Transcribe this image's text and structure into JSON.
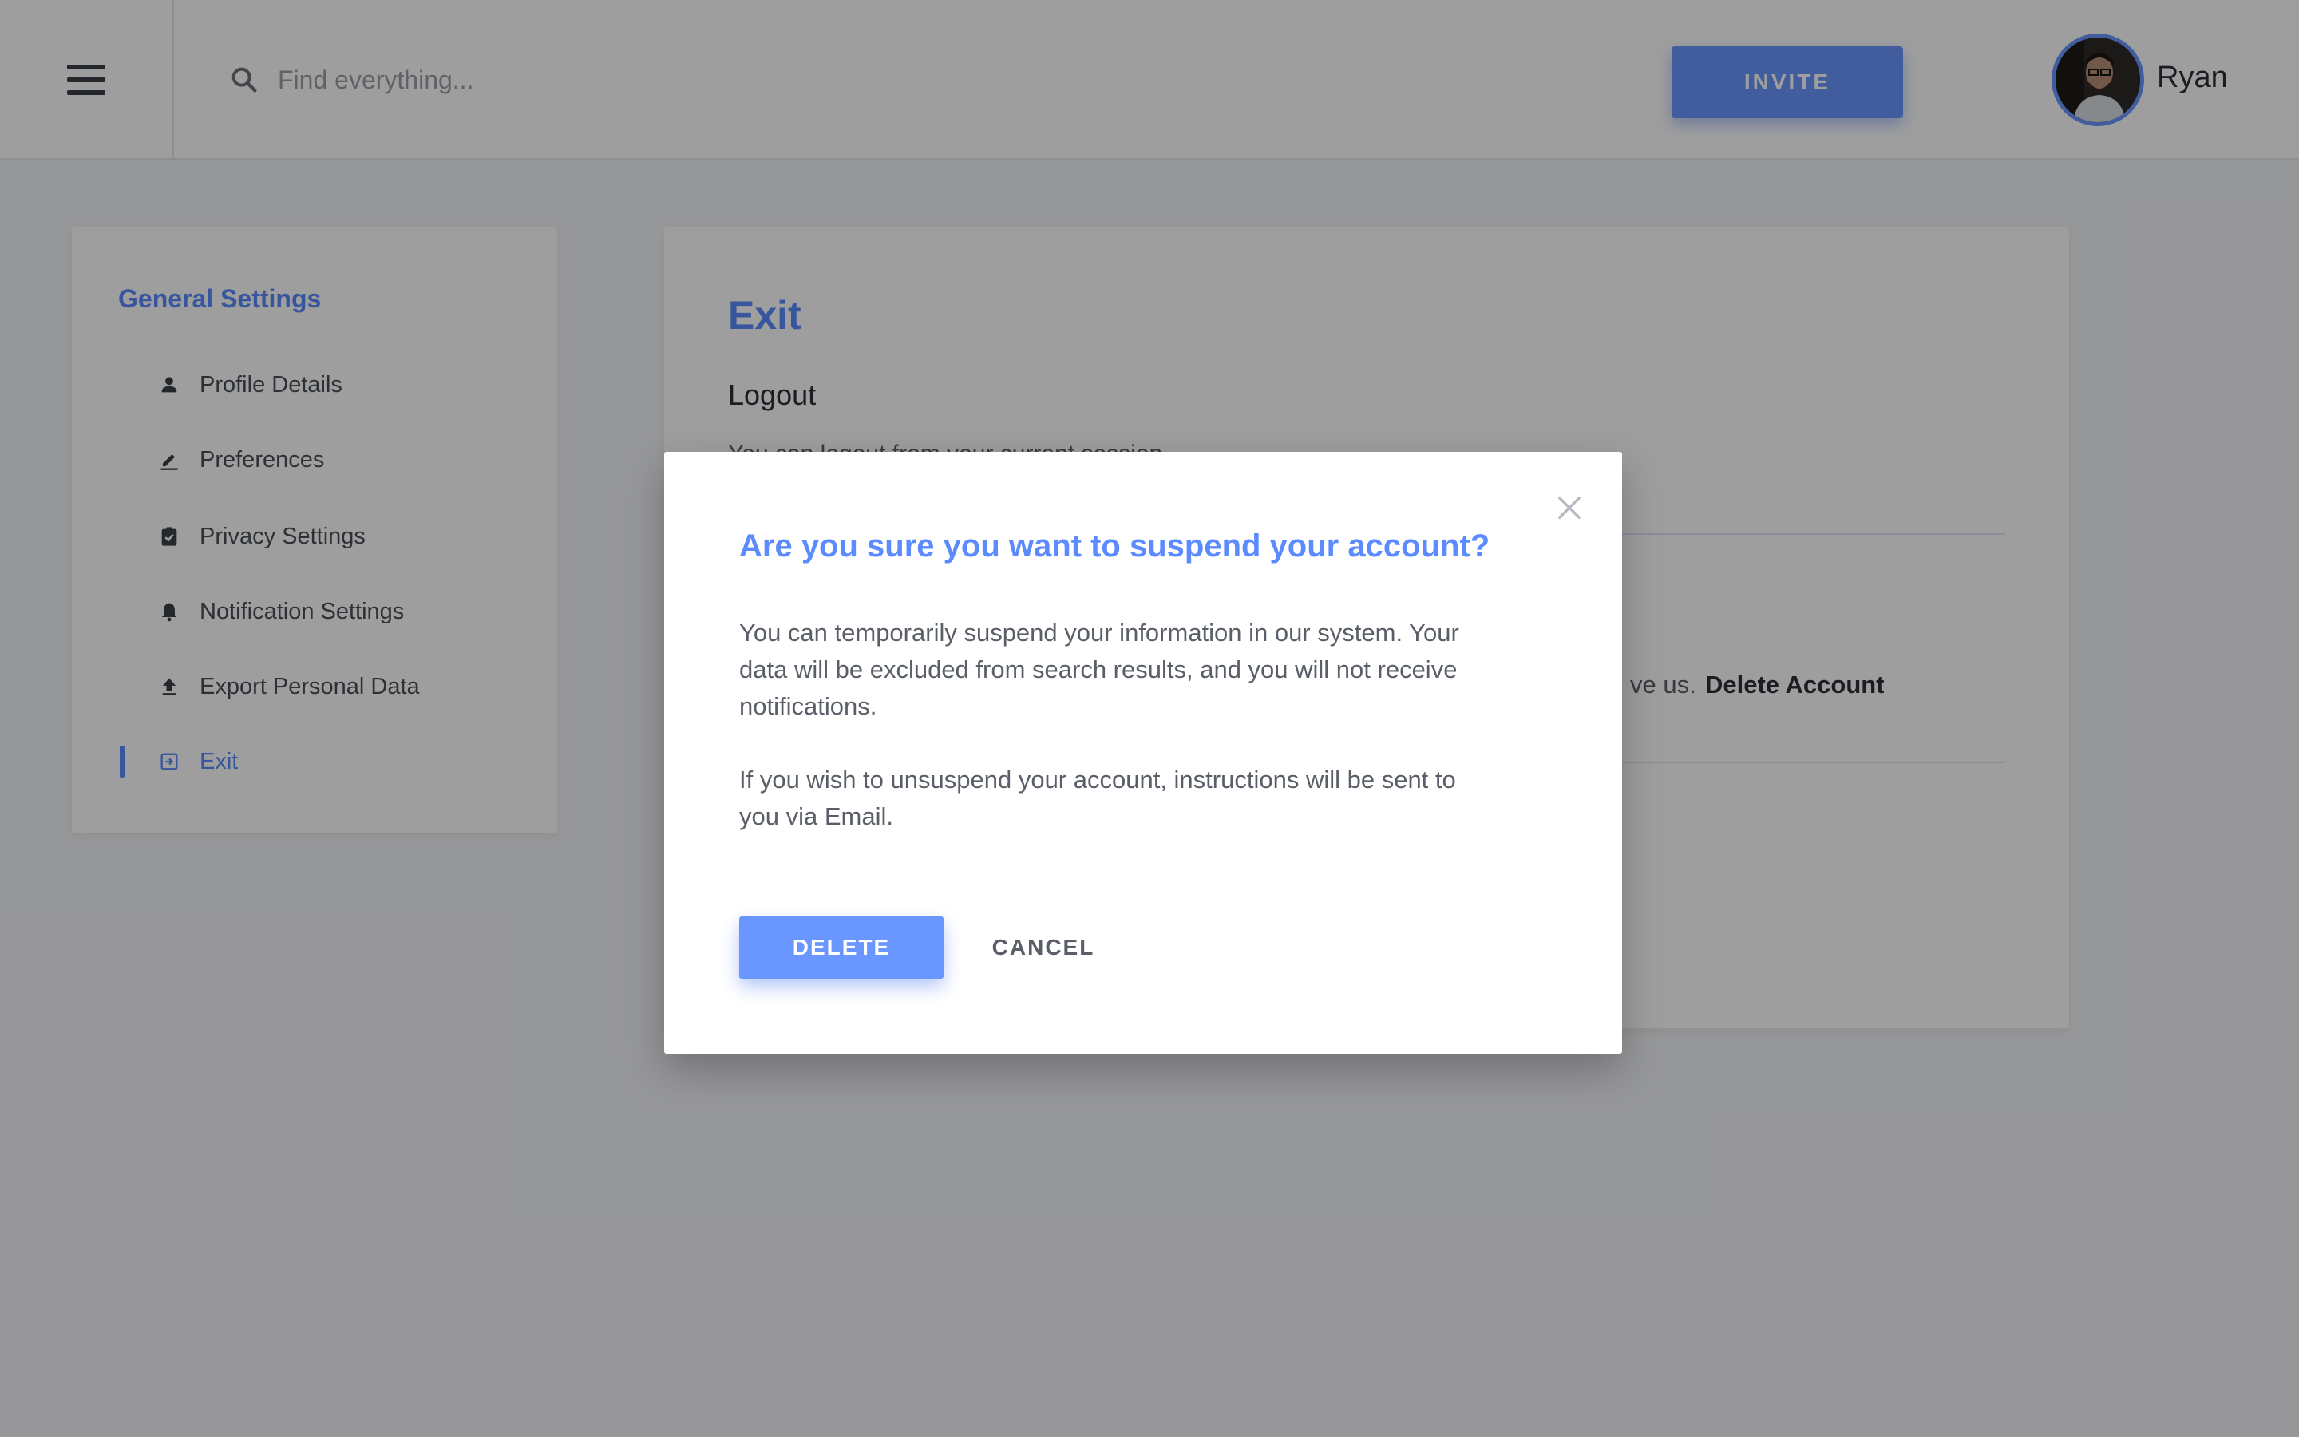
{
  "header": {
    "menu_icon": "hamburger-menu-icon",
    "search": {
      "placeholder": "Find everything...",
      "value": "",
      "icon": "search-icon"
    },
    "invite_label": "INVITE",
    "user": {
      "name": "Ryan",
      "avatar_icon": "user-avatar"
    }
  },
  "sidebar": {
    "title": "General Settings",
    "items": [
      {
        "label": "Profile Details",
        "icon": "person-icon",
        "active": false
      },
      {
        "label": "Preferences",
        "icon": "pencil-icon",
        "active": false
      },
      {
        "label": "Privacy Settings",
        "icon": "clipboard-check-icon",
        "active": false
      },
      {
        "label": "Notification Settings",
        "icon": "bell-icon",
        "active": false
      },
      {
        "label": "Export Personal Data",
        "icon": "upload-icon",
        "active": false
      },
      {
        "label": "Exit",
        "icon": "exit-icon",
        "active": true
      }
    ]
  },
  "main": {
    "title": "Exit",
    "logout_title": "Logout",
    "logout_desc": "You can logout from your current session",
    "delete_desc_fragment": "ve us.",
    "delete_link": "Delete Account"
  },
  "modal": {
    "title": "Are you sure you want to suspend your account?",
    "paragraph1": "You can temporarily suspend your information in our system. Your data will be excluded from search results, and you will not receive notifications.",
    "paragraph2": "If you wish to unsuspend your account, instructions will be sent to you via Email.",
    "delete_label": "DELETE",
    "cancel_label": "CANCEL",
    "close_icon": "close-icon"
  },
  "colors": {
    "accent": "#5b8bff",
    "button": "#6a96ff",
    "overlay": "rgba(0,0,0,0.38)"
  }
}
